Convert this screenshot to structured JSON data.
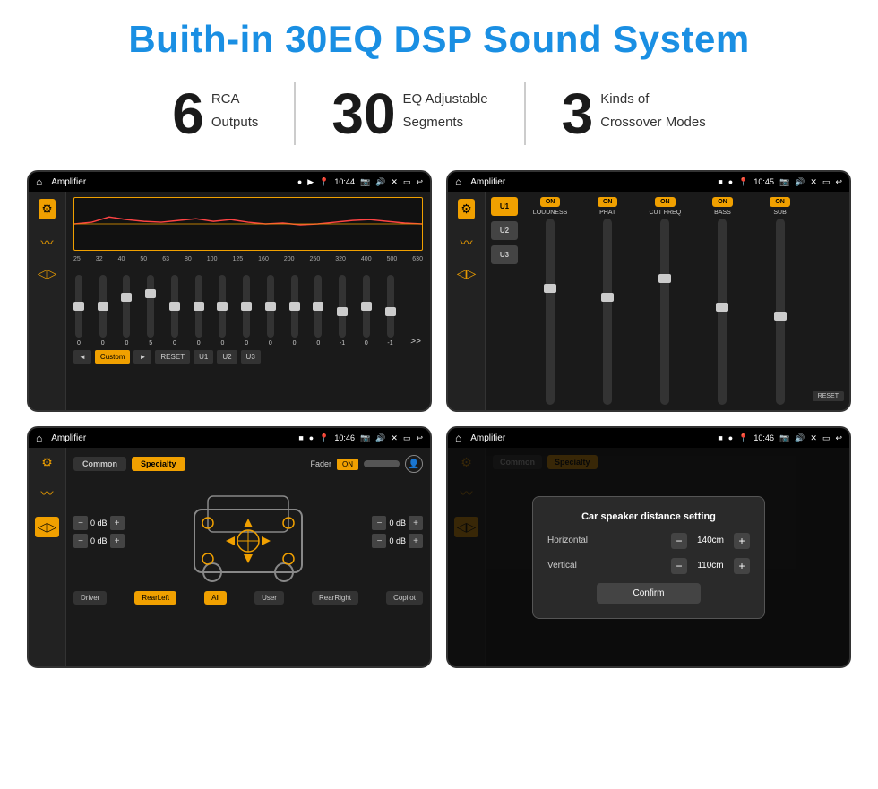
{
  "title": "Buith-in 30EQ DSP Sound System",
  "stats": [
    {
      "number": "6",
      "label_line1": "RCA",
      "label_line2": "Outputs"
    },
    {
      "number": "30",
      "label_line1": "EQ Adjustable",
      "label_line2": "Segments"
    },
    {
      "number": "3",
      "label_line1": "Kinds of",
      "label_line2": "Crossover Modes"
    }
  ],
  "screen1": {
    "status_bar": {
      "title": "Amplifier",
      "time": "10:44"
    },
    "eq_bands": [
      "25",
      "32",
      "40",
      "50",
      "63",
      "80",
      "100",
      "125",
      "160",
      "200",
      "250",
      "320",
      "400",
      "500",
      "630"
    ],
    "eq_values": [
      "0",
      "0",
      "0",
      "5",
      "0",
      "0",
      "0",
      "0",
      "0",
      "0",
      "0",
      "-1",
      "0",
      "-1"
    ],
    "preset_label": "Custom",
    "buttons": [
      "RESET",
      "U1",
      "U2",
      "U3"
    ]
  },
  "screen2": {
    "status_bar": {
      "title": "Amplifier",
      "time": "10:45"
    },
    "presets": [
      "U1",
      "U2",
      "U3"
    ],
    "channels": [
      {
        "name": "LOUDNESS",
        "on": true
      },
      {
        "name": "PHAT",
        "on": true
      },
      {
        "name": "CUT FREQ",
        "on": true
      },
      {
        "name": "BASS",
        "on": true
      },
      {
        "name": "SUB",
        "on": true
      }
    ],
    "reset_label": "RESET"
  },
  "screen3": {
    "status_bar": {
      "title": "Amplifier",
      "time": "10:46"
    },
    "tabs": [
      "Common",
      "Specialty"
    ],
    "active_tab": "Specialty",
    "fader_label": "Fader",
    "fader_on": "ON",
    "speakers": {
      "front_left": "0 dB",
      "front_right": "0 dB",
      "rear_left": "0 dB",
      "rear_right": "0 dB"
    },
    "bottom_btns": [
      "Driver",
      "RearLeft",
      "All",
      "User",
      "RearRight",
      "Copilot"
    ]
  },
  "screen4": {
    "status_bar": {
      "title": "Amplifier",
      "time": "10:46"
    },
    "tabs": [
      "Common",
      "Specialty"
    ],
    "dialog": {
      "title": "Car speaker distance setting",
      "horizontal_label": "Horizontal",
      "horizontal_value": "140cm",
      "vertical_label": "Vertical",
      "vertical_value": "110cm",
      "confirm_label": "Confirm"
    }
  }
}
